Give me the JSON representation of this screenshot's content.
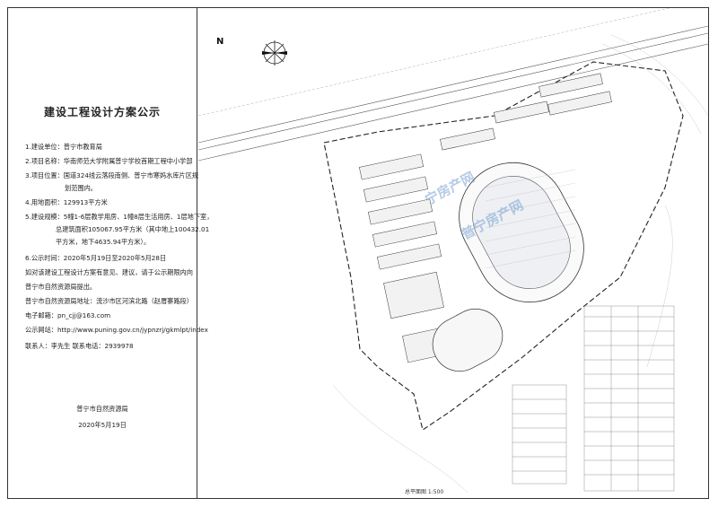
{
  "notice": {
    "title": "建设工程设计方案公示",
    "items": [
      "1.建设单位：普宁市教育局",
      "2.项目名称：华南师范大学附属普宁学校首期工程中小学部",
      "3.项目位置：国道324线云落段南侧、普宁市寒妈水库片区规",
      "划范围内。",
      "4.用地面积：129913平方米",
      "5.建设规模：5幢1-6层教学用房、1幢8层生活用房、1层地下室，",
      "总建筑面积105067.95平方米（其中地上100432.01",
      "平方米，地下4635.94平方米）。",
      "6.公示时间：2020年5月19日至2020年5月28日",
      "如对该建设工程设计方案有意见、建议，请于公示期限内向",
      "普宁市自然资源局提出。",
      "普宁市自然资源局地址：流沙市区河滨北路（赵厝寨路段）",
      "电子邮箱：pn_cjj@163.com",
      "公示网站：http://www.puning.gov.cn/jypnzrj/gkmlpt/index",
      "联系人：李先生    联系电话：2939978"
    ],
    "signature_org": "普宁市自然资源局",
    "signature_date": "2020年5月19日"
  },
  "plan": {
    "north_label": "N",
    "caption": "总平面图  1:500",
    "watermarks": [
      "宁房产网",
      "普宁房产网"
    ]
  }
}
